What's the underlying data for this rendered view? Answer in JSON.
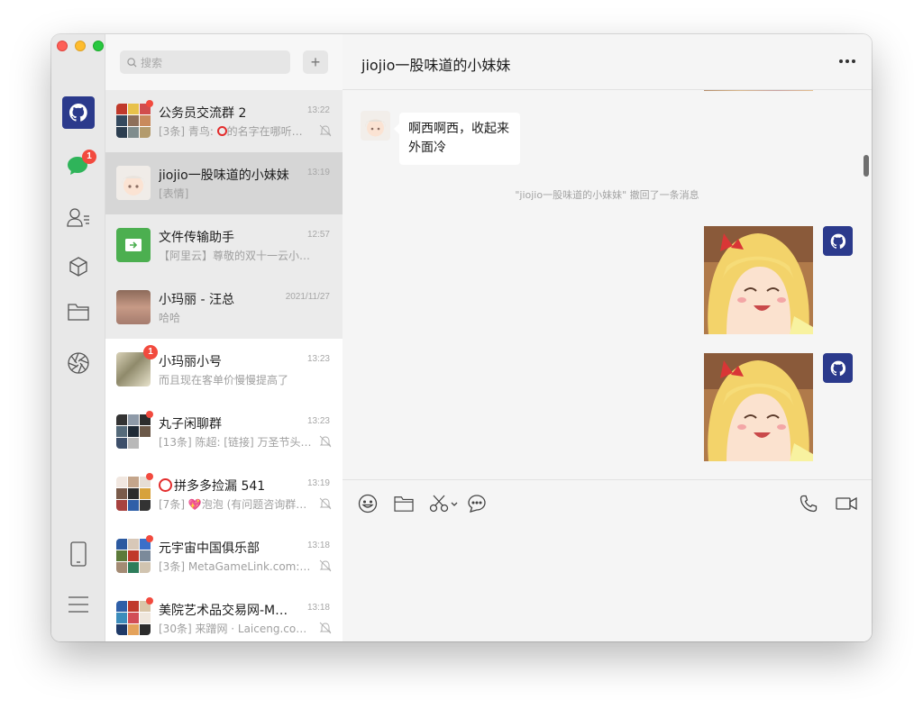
{
  "window": {
    "title": "jiojio一股味道的小妹妹"
  },
  "nav": {
    "chat_badge": "1",
    "icons": [
      "github-avatar",
      "chat-icon",
      "contacts-icon",
      "favorites-icon",
      "folder-icon",
      "moments-icon",
      "phone-icon",
      "menu-icon"
    ]
  },
  "search": {
    "placeholder": "搜索",
    "add_label": "+"
  },
  "chats": [
    {
      "name": "公务员交流群 2",
      "time": "13:22",
      "preview_prefix": "[3条] 青鸟: ",
      "preview_ring": true,
      "preview": "的名字在哪听…",
      "muted": true,
      "dot": true
    },
    {
      "name": "jiojio一股味道的小妹妹",
      "time": "13:19",
      "preview": "[表情]",
      "muted": false,
      "dot": false
    },
    {
      "name": "文件传输助手",
      "time": "12:57",
      "preview": "【阿里云】尊敬的双十一云小宝…",
      "muted": false,
      "dot": false
    },
    {
      "name": "小玛丽 - 汪总",
      "time": "2021/11/27",
      "preview": "哈哈",
      "muted": false,
      "dot": false
    },
    {
      "name": "小玛丽小号",
      "time": "13:23",
      "preview": "而且现在客单价慢慢提高了",
      "muted": false,
      "badge": "1"
    },
    {
      "name": "丸子闲聊群",
      "time": "13:23",
      "preview": "[13条] 陈超: [链接] 万圣节头…",
      "muted": true,
      "dot": true
    },
    {
      "name": "拼多多捡漏 541",
      "time": "13:19",
      "preview_prefix": "[7条] ",
      "preview_heart": true,
      "preview": "泡泡 (有问题咨询群…",
      "muted": true,
      "dot": true,
      "name_ring": true
    },
    {
      "name": "元宇宙中国俱乐部",
      "time": "13:18",
      "preview": "[3条] MetaGameLink.com: nf…",
      "muted": true,
      "dot": true
    },
    {
      "name": "美院艺术品交易网-Me...",
      "time": "13:18",
      "preview": "[30条] 来蹭网 · Laiceng.com:…",
      "muted": true,
      "dot": true
    }
  ],
  "conversation": {
    "incoming_text_line1": "啊西啊西，收起来",
    "incoming_text_line2": "外面冷",
    "recall_notice": "\"jiojio一股味道的小妹妹\" 撤回了一条消息"
  },
  "toolbar": {
    "icons": [
      "emoji-icon",
      "folder-icon",
      "scissors-icon",
      "chat-bubble-icon",
      "phone-icon",
      "video-icon"
    ]
  },
  "colors": {
    "badge": "#f24a3e",
    "file_transfer": "#4caf50",
    "github_avatar": "#2b3a8c"
  }
}
